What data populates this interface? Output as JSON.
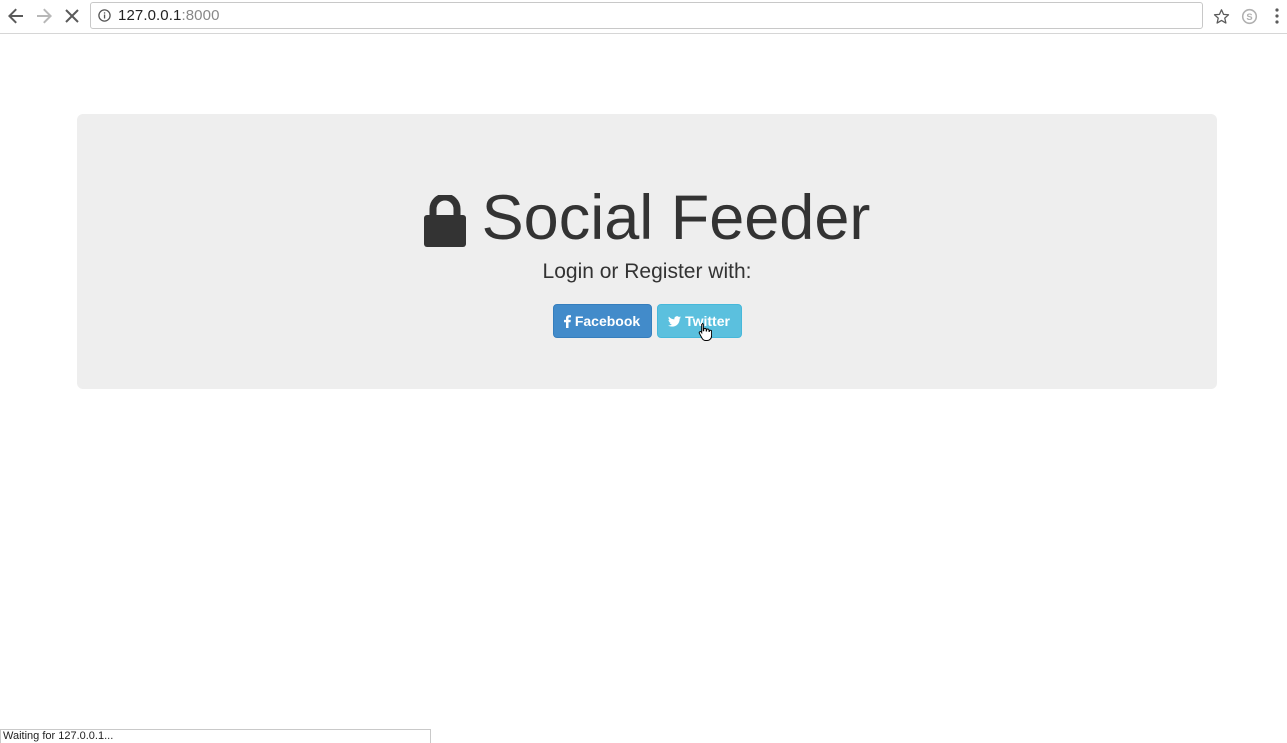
{
  "browser": {
    "url_host": "127.0.0.1",
    "url_port": ":8000",
    "status_text": "Waiting for 127.0.0.1..."
  },
  "icons": {
    "back": "back-arrow-icon",
    "forward": "forward-arrow-icon",
    "stop": "stop-icon",
    "info": "info-icon",
    "star": "star-icon",
    "skype": "skype-icon",
    "menu": "menu-icon",
    "lock": "lock-icon",
    "facebook": "facebook-icon",
    "twitter": "twitter-icon"
  },
  "page": {
    "title": "Social Feeder",
    "subtitle": "Login or Register with:",
    "buttons": {
      "facebook_label": "Facebook",
      "twitter_label": "Twitter"
    }
  },
  "colors": {
    "jumbotron_bg": "#eeeeee",
    "facebook_btn": "#428bca",
    "twitter_btn": "#5bc0de",
    "text": "#333333"
  }
}
